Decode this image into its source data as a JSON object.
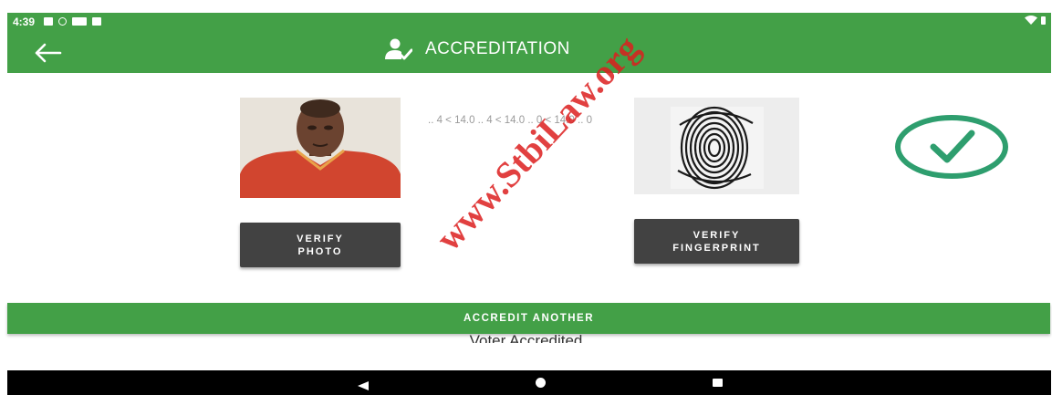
{
  "status_bar": {
    "time": "4:39",
    "background": "#43a047"
  },
  "app_bar": {
    "title": "ACCREDITATION",
    "back_icon": "arrow-left-icon",
    "title_icon": "user-check-icon",
    "background": "#43a047"
  },
  "capture": {
    "scan_readout": ".. 4 < 14.0 .. 4 < 14.0 .. 0 < 14.0 .. 0",
    "photo_label": "voter-photo",
    "fingerprint_label": "fingerprint-scan"
  },
  "buttons": {
    "verify_photo_line1": "VERIFY",
    "verify_photo_line2": "PHOTO",
    "verify_fp_line1": "VERIFY",
    "verify_fp_line2": "FINGERPRINT",
    "accredit_another": "ACCREDIT ANOTHER",
    "button_color": "#424242"
  },
  "result": {
    "status_text": "Voter Accredited",
    "check_icon": "check-circle-icon",
    "check_color": "#2e9e6e"
  },
  "watermark": {
    "text": "www.StbiLaw.org",
    "color": "#dc1e1e"
  },
  "nav_bar": {
    "back_icon": "nav-back-icon",
    "home_icon": "nav-home-icon",
    "recent_icon": "nav-recent-icon"
  }
}
